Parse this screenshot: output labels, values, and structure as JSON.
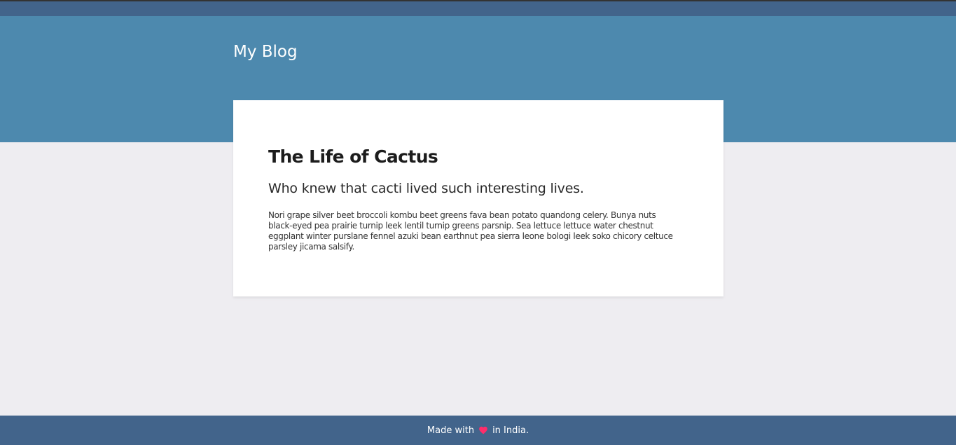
{
  "header": {
    "site_title": "My Blog"
  },
  "post": {
    "title": "The Life of Cactus",
    "subtitle": "Who knew that cacti lived such interesting lives.",
    "body": "Nori grape silver beet broccoli kombu beet greens fava bean potato quandong celery. Bunya nuts black-eyed pea prairie turnip leek lentil turnip greens parsnip. Sea lettuce lettuce water chestnut eggplant winter purslane fennel azuki bean earthnut pea sierra leone bologi leek soko chicory celtuce parsley jicama salsify."
  },
  "footer": {
    "made_with": "Made with",
    "in_location": "in India.",
    "heart_icon": "heart-icon"
  },
  "colors": {
    "topbar": "#42648b",
    "hero": "#4d89ae",
    "background": "#eeedf1",
    "card": "#ffffff",
    "footer": "#42648b",
    "heart": "#ff2d6b"
  }
}
